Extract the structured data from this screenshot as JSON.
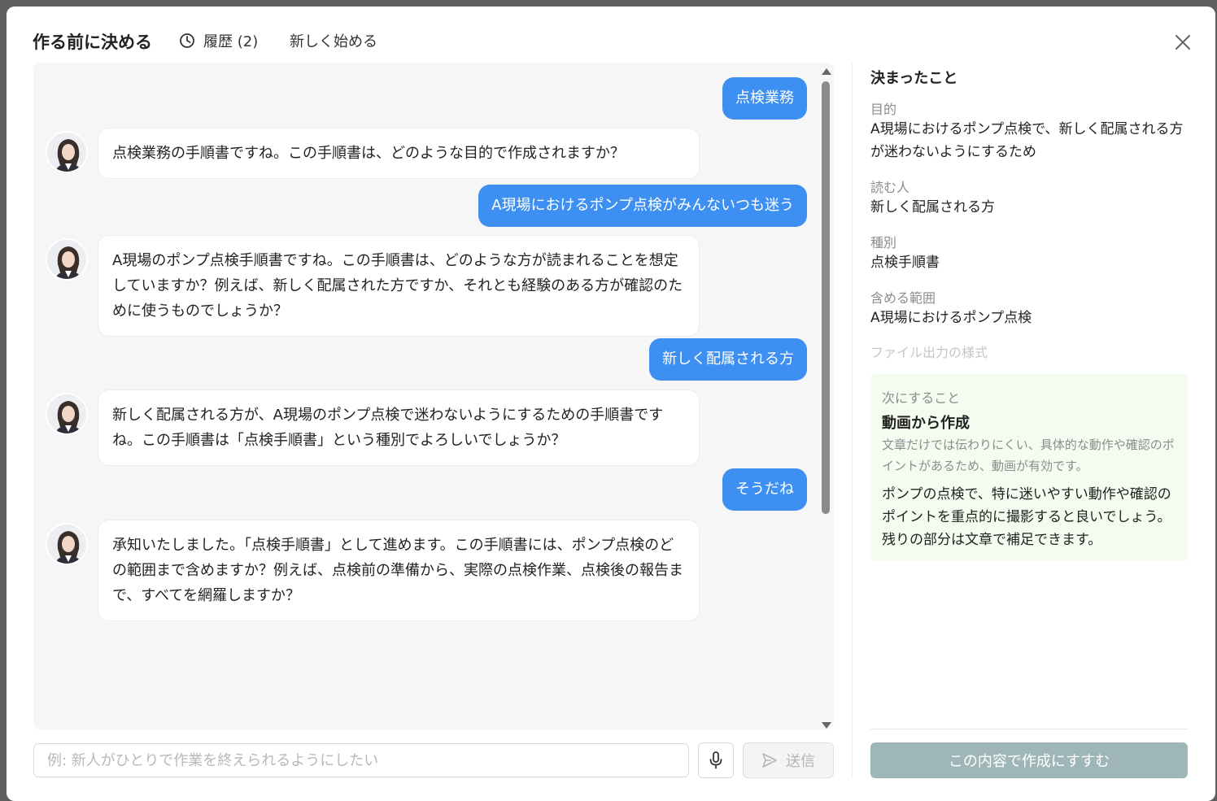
{
  "header": {
    "title": "作る前に決める",
    "history_label": "履歴 (2)",
    "new_label": "新しく始める"
  },
  "chat": {
    "messages": [
      {
        "role": "user",
        "text": "点検業務"
      },
      {
        "role": "assistant",
        "text": "点検業務の手順書ですね。この手順書は、どのような目的で作成されますか？"
      },
      {
        "role": "user",
        "text": "A現場におけるポンプ点検がみんないつも迷う"
      },
      {
        "role": "assistant",
        "text": "A現場のポンプ点検手順書ですね。この手順書は、どのような方が読まれることを想定していますか？例えば、新しく配属された方ですか、それとも経験のある方が確認のために使うものでしょうか？"
      },
      {
        "role": "user",
        "text": "新しく配属される方"
      },
      {
        "role": "assistant",
        "text": "新しく配属される方が、A現場のポンプ点検で迷わないようにするための手順書ですね。この手順書は「点検手順書」という種別でよろしいでしょうか？"
      },
      {
        "role": "user",
        "text": "そうだね"
      },
      {
        "role": "assistant",
        "text": "承知いたしました。「点検手順書」として進めます。この手順書には、ポンプ点検のどの範囲まで含めますか？例えば、点検前の準備から、実際の点検作業、点検後の報告まで、すべてを網羅しますか？"
      }
    ]
  },
  "input": {
    "placeholder": "例: 新人がひとりで作業を終えられるようにしたい",
    "value": "",
    "send_label": "送信"
  },
  "decided": {
    "title": "決まったこと",
    "fields": [
      {
        "label": "目的",
        "value": "A現場におけるポンプ点検で、新しく配属される方が迷わないようにするため"
      },
      {
        "label": "読む人",
        "value": "新しく配属される方"
      },
      {
        "label": "種別",
        "value": "点検手順書"
      },
      {
        "label": "含める範囲",
        "value": "A現場におけるポンプ点検"
      },
      {
        "label": "ファイル出力の様式",
        "value": ""
      }
    ]
  },
  "next": {
    "label": "次にすること",
    "title": "動画から作成",
    "reason": "文章だけでは伝わりにくい、具体的な動作や確認のポイントがあるため、動画が有効です。",
    "detail": "ポンプの点検で、特に迷いやすい動作や確認のポイントを重点的に撮影すると良いでしょう。残りの部分は文章で補足できます。"
  },
  "proceed_label": "この内容で作成にすすむ",
  "colors": {
    "user_bubble": "#3d8ff2",
    "next_box_bg": "#f3fcee",
    "proceed_button": "#9fb6b8"
  }
}
